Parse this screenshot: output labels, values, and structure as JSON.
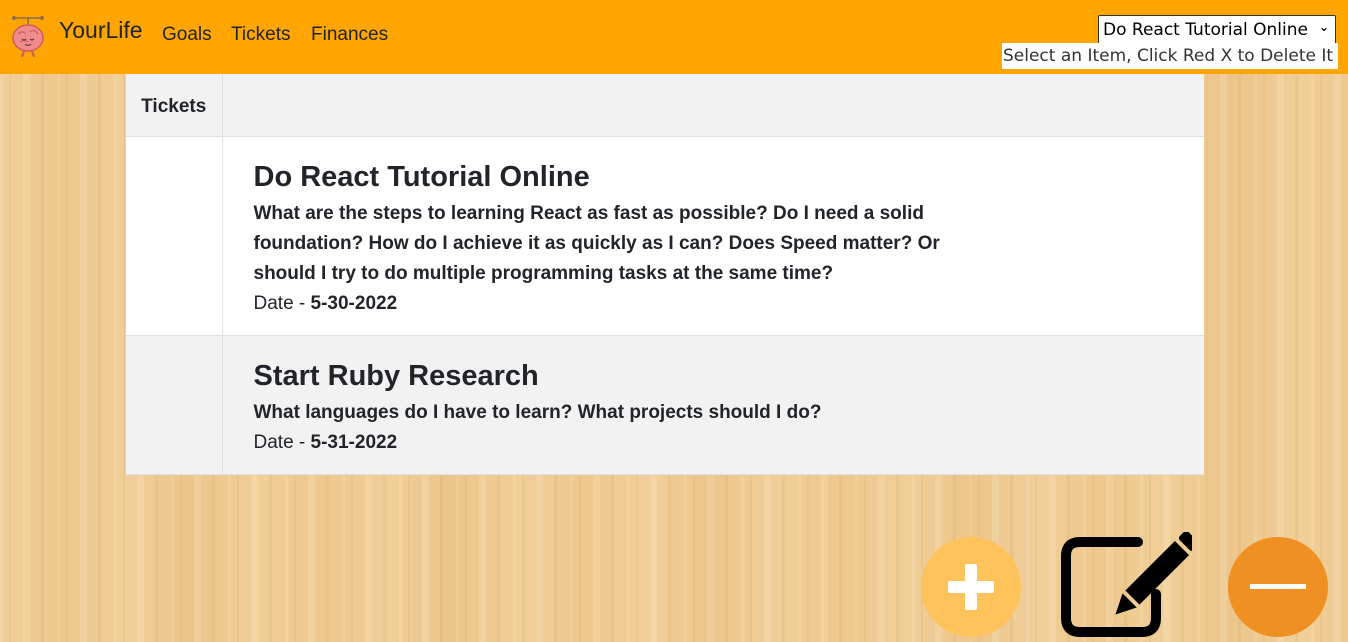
{
  "navbar": {
    "brand": "YourLife",
    "links": [
      "Goals",
      "Tickets",
      "Finances"
    ],
    "selected_item": "Do React Tutorial Online",
    "delete_hint": "Select an Item, Click Red X to Delete It",
    "color": "#ffa500"
  },
  "table": {
    "header": "Tickets",
    "rows": [
      {
        "title": "Do React Tutorial Online",
        "description": "What are the steps to learning React as fast as possible? Do I need a solid foundation? How do I achieve it as quickly as I can? Does Speed matter? Or should I try to do multiple programming tasks at the same time?",
        "date_label": "Date - ",
        "date": "5-30-2022"
      },
      {
        "title": "Start Ruby Research",
        "description": "What languages do I have to learn? What projects should I do?",
        "date_label": "Date - ",
        "date": "5-31-2022"
      }
    ]
  },
  "buttons": {
    "add_icon": "plus-icon",
    "edit_icon": "edit-icon",
    "remove_icon": "minus-icon",
    "add_color": "#ffc35c",
    "remove_color": "#f09022"
  }
}
